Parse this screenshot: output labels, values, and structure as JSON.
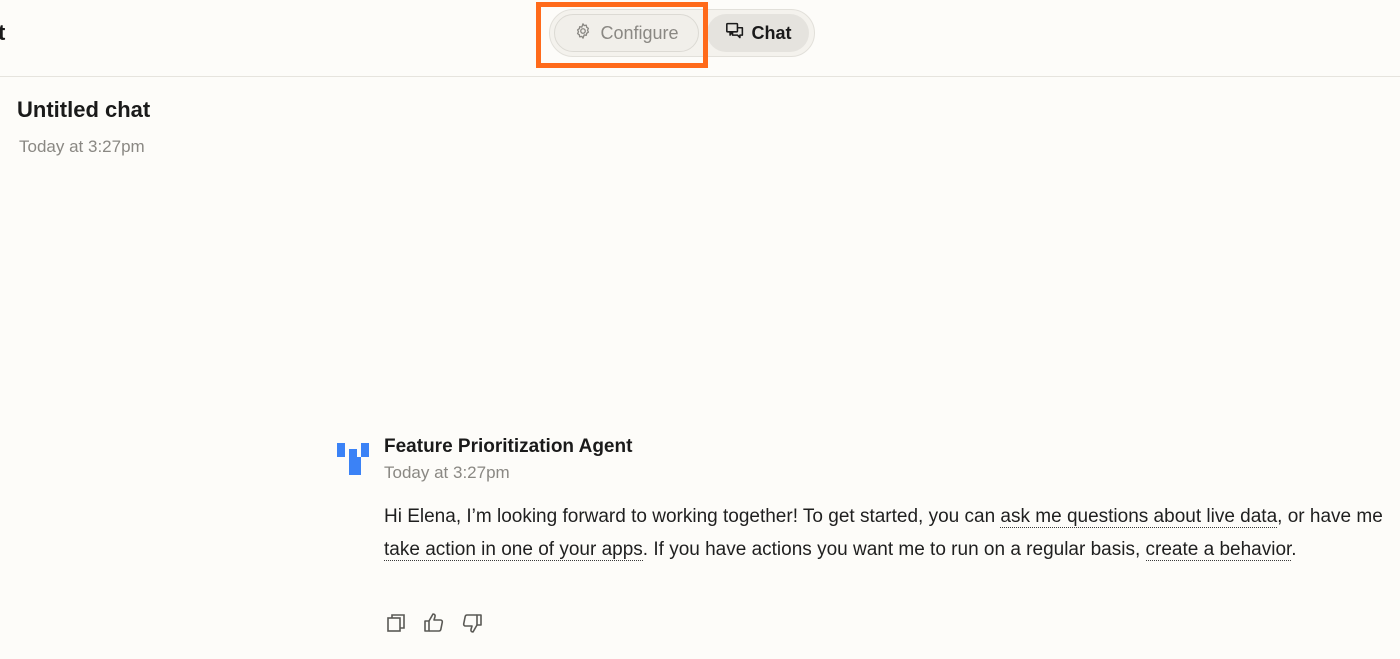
{
  "header": {
    "cut_title": "t",
    "configure_label": "Configure",
    "chat_label": "Chat"
  },
  "chat": {
    "title": "Untitled chat",
    "timestamp": "Today at 3:27pm"
  },
  "message": {
    "agent_name": "Feature Prioritization Agent",
    "timestamp": "Today at 3:27pm",
    "text_1": "Hi Elena, I’m looking forward to working together! To get started, you can ",
    "link_1": "ask me questions about live data",
    "text_2": ", or have me ",
    "link_2": "take action in one of your apps",
    "text_3": ". If you have actions you want me to run on a regular basis, ",
    "link_3": "create a behavior",
    "text_4": "."
  },
  "icons": {
    "configure": "gear-icon",
    "chat": "chat-bubbles-icon",
    "agent": "agent-logo-icon",
    "copy": "copy-icon",
    "thumbs_up": "thumbs-up-icon",
    "thumbs_down": "thumbs-down-icon"
  },
  "colors": {
    "highlight": "#ff6a1a",
    "agent_logo": "#3b82f6",
    "background": "#fdfcf9"
  }
}
